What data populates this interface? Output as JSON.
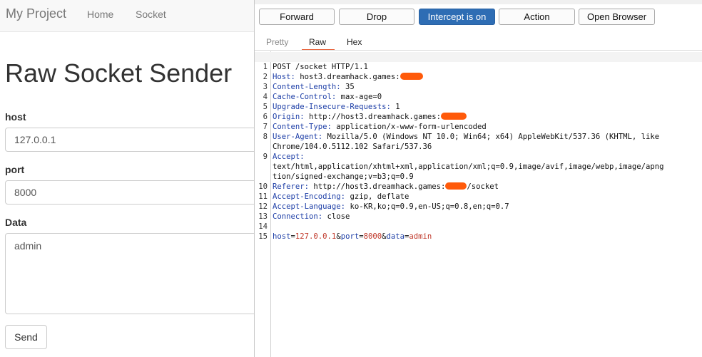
{
  "webpage": {
    "brand": "My Project",
    "nav": [
      "Home",
      "Socket"
    ],
    "title": "Raw Socket Sender",
    "host_label": "host",
    "host_value": "127.0.0.1",
    "port_label": "port",
    "port_value": "8000",
    "data_label": "Data",
    "data_value": "admin",
    "send_label": "Send"
  },
  "burp": {
    "toolbar": [
      "Forward",
      "Drop",
      "Intercept is on",
      "Action",
      "Open Browser"
    ],
    "tabs": [
      "Pretty",
      "Raw",
      "Hex"
    ],
    "selected_tab": "Raw",
    "accent_color": "#e8643c",
    "intercept_color": "#2e6db4",
    "redaction_color": "#ff5a0a",
    "request": {
      "l1": "POST /socket HTTP/1.1",
      "host_k": "Host:",
      "host_v": " host3.dreamhack.games:",
      "cl_k": "Content-Length:",
      "cl_v": " 35",
      "cc_k": "Cache-Control:",
      "cc_v": " max-age=0",
      "uir_k": "Upgrade-Insecure-Requests:",
      "uir_v": " 1",
      "origin_k": "Origin:",
      "origin_v": " http://host3.dreamhack.games:",
      "ct_k": "Content-Type:",
      "ct_v": " application/x-www-form-urlencoded",
      "ua_k": "User-Agent:",
      "ua_v": " Mozilla/5.0 (Windows NT 10.0; Win64; x64) AppleWebKit/537.36 (KHTML, like",
      "ua_v2": "Chrome/104.0.5112.102 Safari/537.36",
      "acc_k": "Accept:",
      "acc_v": "text/html,application/xhtml+xml,application/xml;q=0.9,image/avif,image/webp,image/apng",
      "acc_v2": "tion/signed-exchange;v=b3;q=0.9",
      "ref_k": "Referer:",
      "ref_v": " http://host3.dreamhack.games:",
      "ref_v2": "/socket",
      "ae_k": "Accept-Encoding:",
      "ae_v": " gzip, deflate",
      "al_k": "Accept-Language:",
      "al_v": " ko-KR,ko;q=0.9,en-US;q=0.8,en;q=0.7",
      "conn_k": "Connection:",
      "conn_v": " close",
      "body": {
        "k1": "host",
        "v1": "127.0.0.1",
        "k2": "port",
        "v2": "8000",
        "k3": "data",
        "v3": "admin"
      }
    }
  }
}
